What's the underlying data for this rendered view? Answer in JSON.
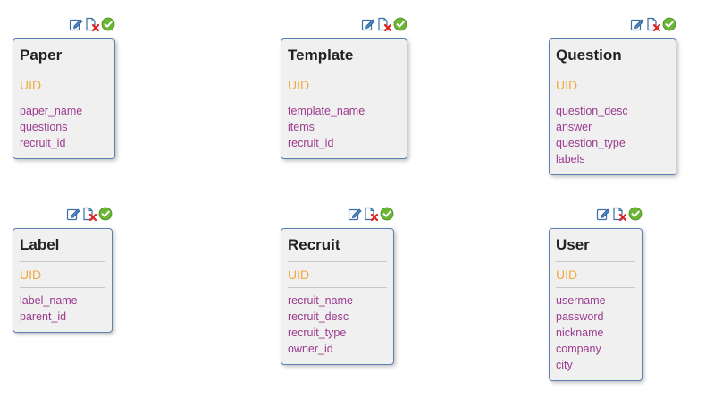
{
  "colors": {
    "border": "#5b7fb0",
    "title": "#222222",
    "uid": "#f2a93b",
    "field": "#9b3b8f",
    "box_bg": "#f0f0f0"
  },
  "icons": [
    "edit-icon",
    "delete-icon",
    "confirm-icon"
  ],
  "entities": [
    {
      "title": "Paper",
      "uid": "UID",
      "fields": [
        "paper_name",
        "questions",
        "recruit_id"
      ]
    },
    {
      "title": "Template",
      "uid": "UID",
      "fields": [
        "template_name",
        "items",
        "recruit_id"
      ]
    },
    {
      "title": "Question",
      "uid": "UID",
      "fields": [
        "question_desc",
        "answer",
        "question_type",
        "labels"
      ]
    },
    {
      "title": "Label",
      "uid": "UID",
      "fields": [
        "label_name",
        "parent_id"
      ]
    },
    {
      "title": "Recruit",
      "uid": "UID",
      "fields": [
        "recruit_name",
        "recruit_desc",
        "recruit_type",
        "owner_id"
      ]
    },
    {
      "title": "User",
      "uid": "UID",
      "fields": [
        "username",
        "password",
        "nickname",
        "company",
        "city"
      ]
    }
  ]
}
